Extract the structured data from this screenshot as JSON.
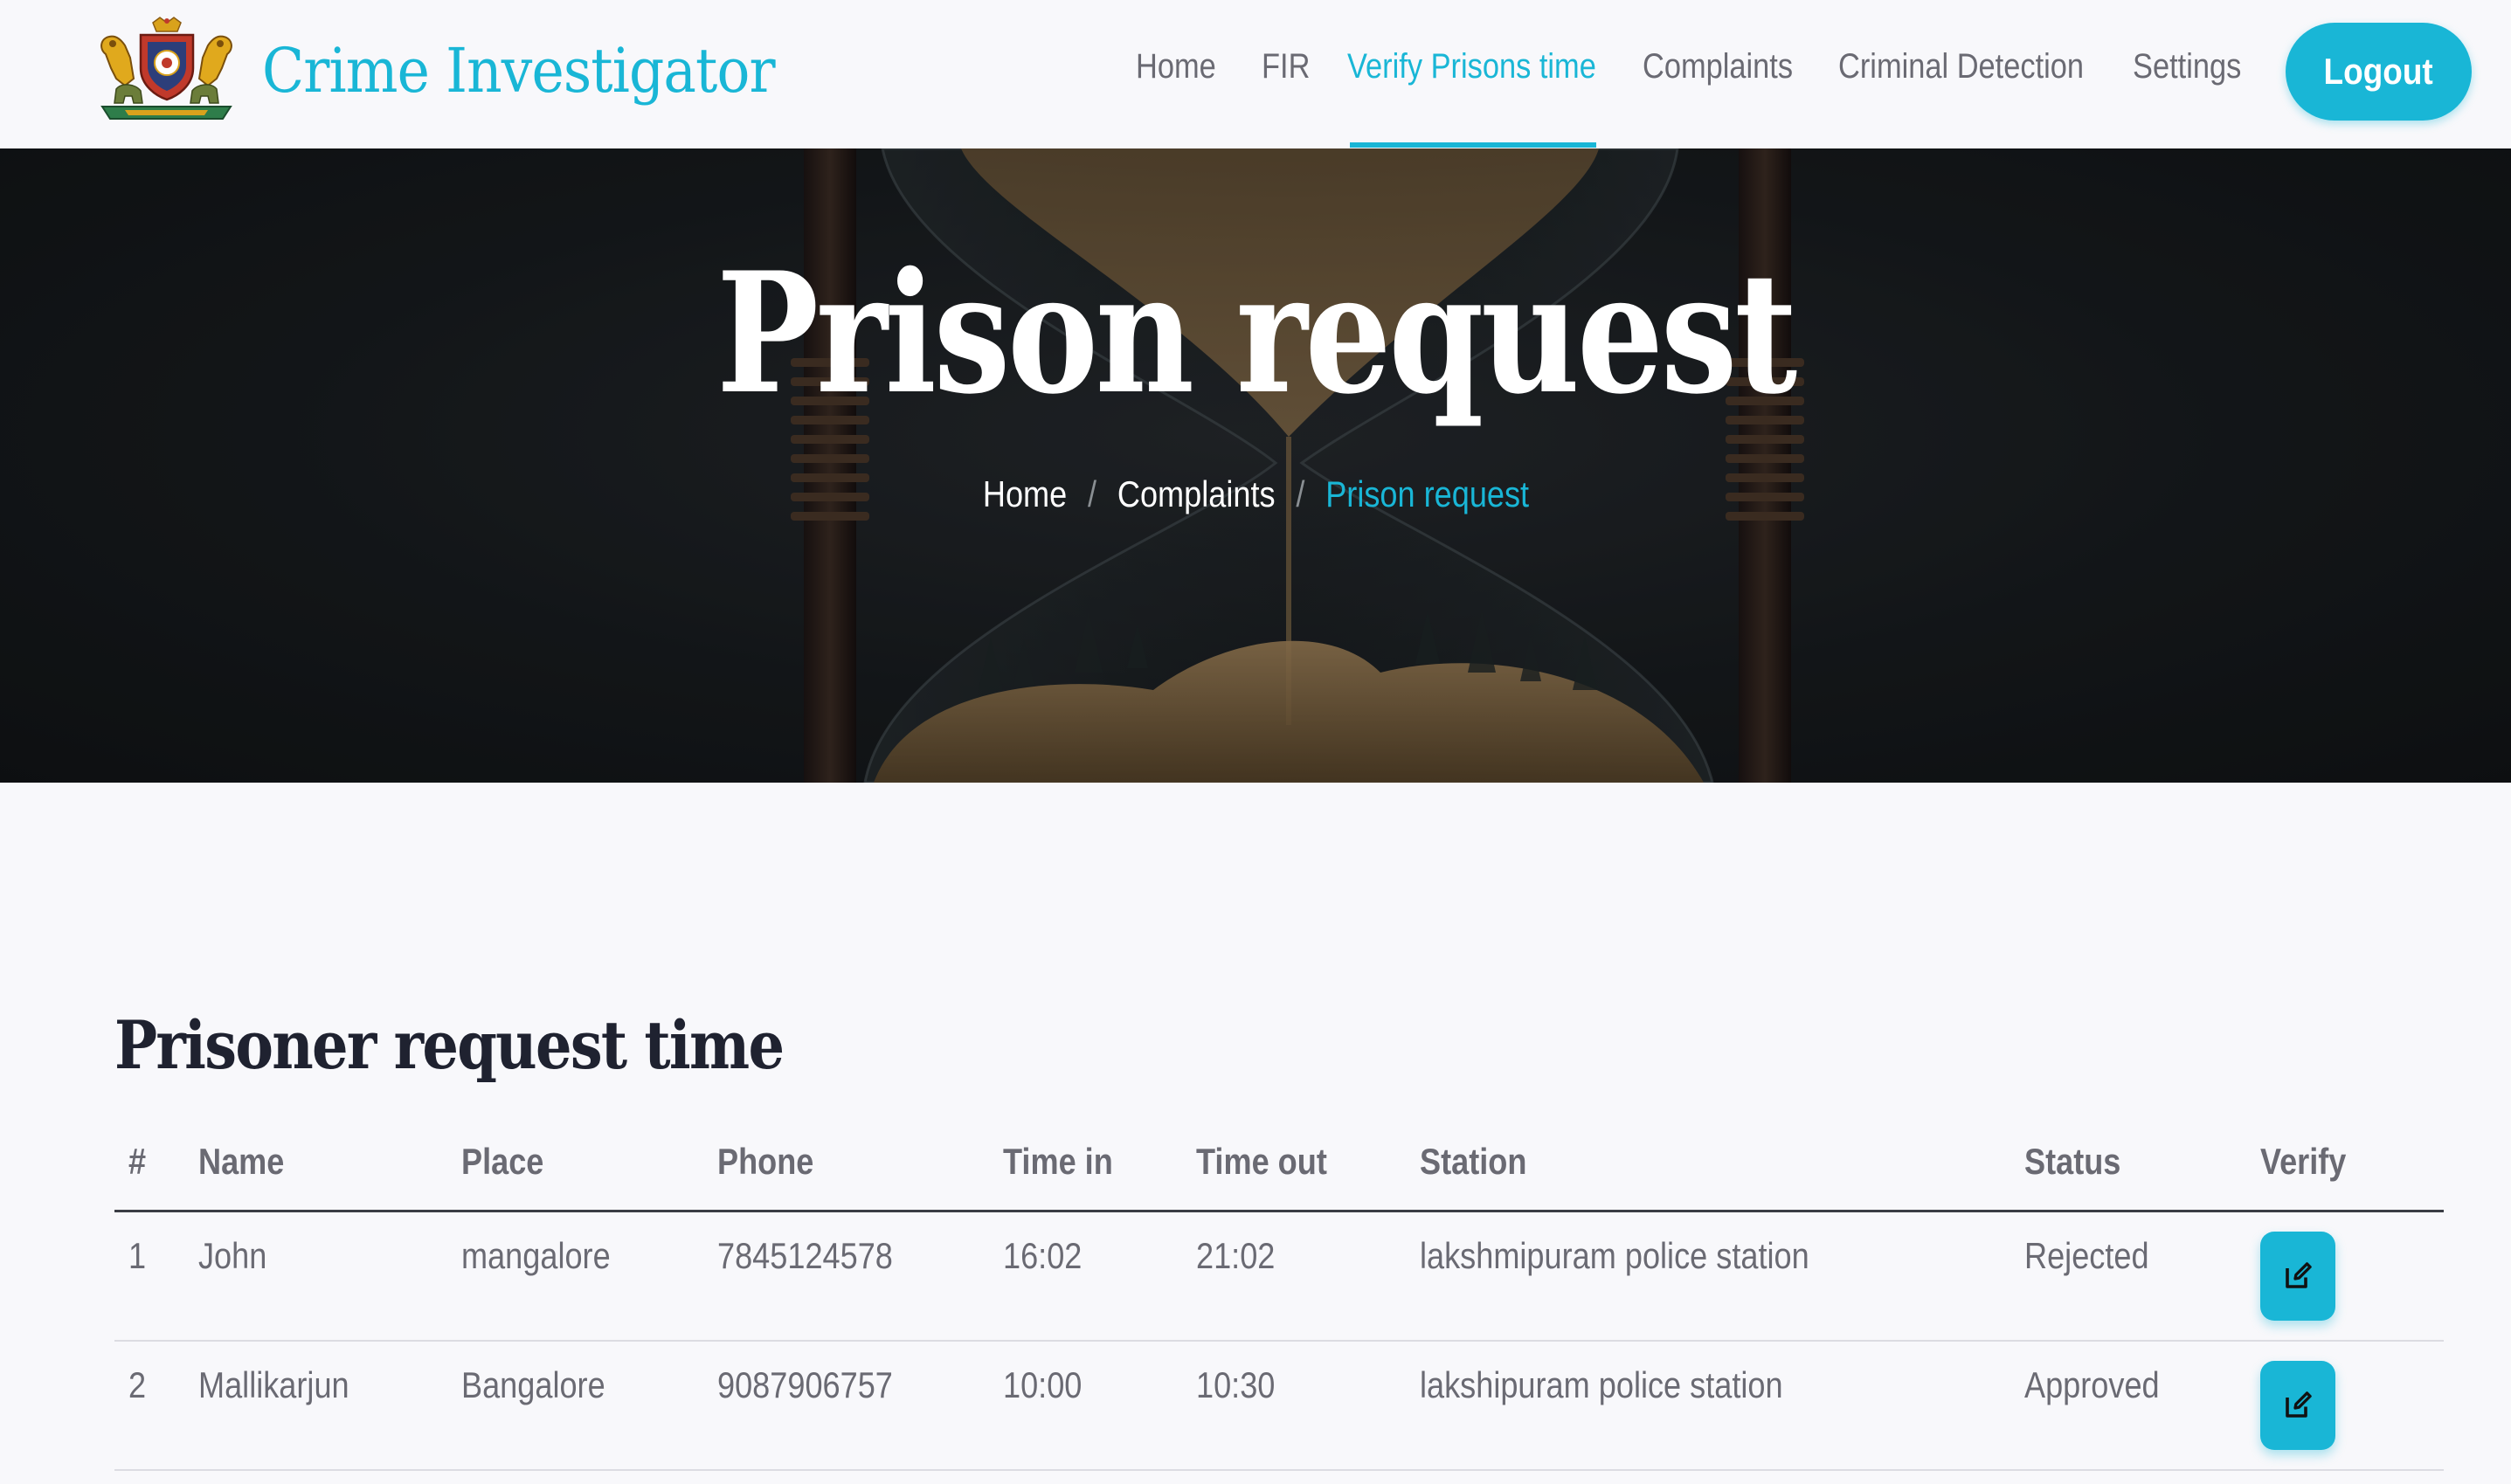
{
  "brand": {
    "title": "Crime Investigator",
    "logo_icon": "karnataka-emblem-icon"
  },
  "nav": {
    "items": [
      {
        "label": "Home",
        "active": false
      },
      {
        "label": "FIR",
        "active": false
      },
      {
        "label": "Verify Prisons time",
        "active": true
      },
      {
        "label": "Complaints",
        "active": false
      },
      {
        "label": "Criminal Detection",
        "active": false
      },
      {
        "label": "Settings",
        "active": false
      }
    ],
    "logout_label": "Logout"
  },
  "hero": {
    "title": "Prison request",
    "background_icon": "hourglass-image",
    "breadcrumb": {
      "items": [
        "Home",
        "Complaints"
      ],
      "current": "Prison request",
      "separator": "/"
    }
  },
  "section": {
    "title": "Prisoner request time"
  },
  "table": {
    "headers": [
      "#",
      "Name",
      "Place",
      "Phone",
      "Time in",
      "Time out",
      "Station",
      "Status",
      "Verify"
    ],
    "rows": [
      {
        "num": "1",
        "name": "John",
        "place": "mangalore",
        "phone": "7845124578",
        "time_in": "16:02",
        "time_out": "21:02",
        "station": "lakshmipuram police station",
        "status": "Rejected",
        "verify_icon": "edit-icon"
      },
      {
        "num": "2",
        "name": "Mallikarjun",
        "place": "Bangalore",
        "phone": "9087906757",
        "time_in": "10:00",
        "time_out": "10:30",
        "station": "lakshipuram police station",
        "status": "Approved",
        "verify_icon": "edit-icon"
      }
    ]
  },
  "colors": {
    "accent": "#19b6d6",
    "text": "#6a6a73",
    "heading": "#1f2230",
    "background": "#f8f8fb"
  }
}
